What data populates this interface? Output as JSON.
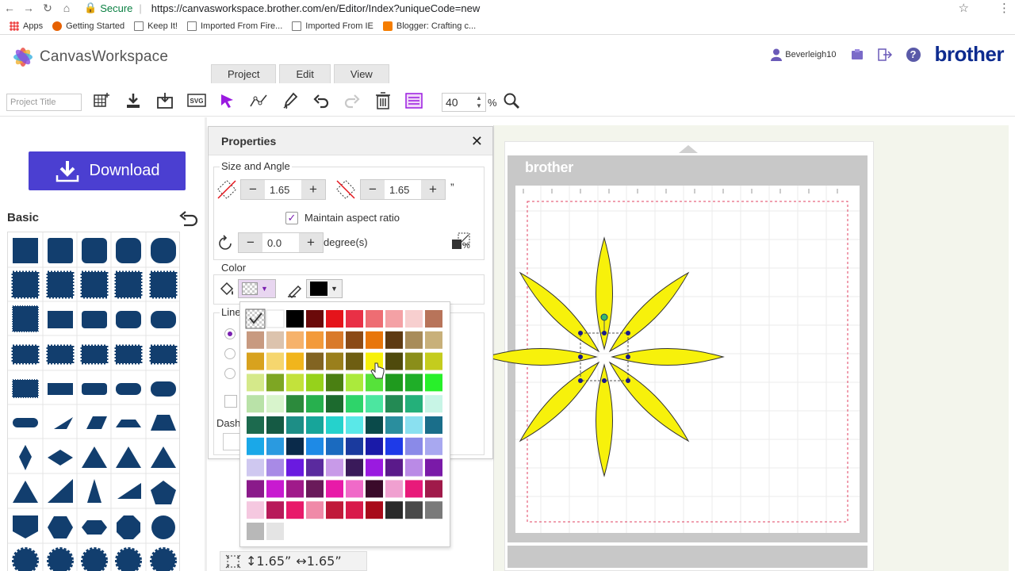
{
  "browser": {
    "secure_label": "Secure",
    "url": "https://canvasworkspace.brother.com/en/Editor/Index?uniqueCode=new",
    "bookmarks": [
      "Apps",
      "Getting Started",
      "Keep It!",
      "Imported From Fire...",
      "Imported From IE",
      "Blogger: Crafting c..."
    ]
  },
  "app": {
    "logo_text": "CanvasWorkspace",
    "tabs": [
      "Project",
      "Edit",
      "View"
    ],
    "username": "Beverleigh10",
    "brand": "brother"
  },
  "toolbar": {
    "project_title_placeholder": "Project Title",
    "zoom_value": "40",
    "zoom_unit": "%"
  },
  "left": {
    "download_label": "Download",
    "basic_title": "Basic"
  },
  "properties": {
    "title": "Properties",
    "size_angle_title": "Size and Angle",
    "width_value": "1.65",
    "height_value": "1.65",
    "unit_mark": "”",
    "maintain_aspect": "Maintain aspect ratio",
    "rotation_value": "0.0",
    "rotation_unit": "degree(s)",
    "color_title": "Color",
    "line_title_partial": "Line",
    "dash_title_partial": "Dash",
    "scale_icon_text": "%"
  },
  "palette": {
    "rows": [
      [
        "#e0e0e0",
        "#ffffff",
        "#000000",
        "#6b0a0a",
        "#e5141b",
        "#e93046",
        "#ee6d73",
        "#f4a1a5",
        "#f7cfcf",
        "#b8745a"
      ],
      [
        "#c89a80",
        "#dcc3ad",
        "#f6b26b",
        "#f39a3a",
        "#d97a2a",
        "#8b4a16",
        "#e8760b",
        "#5e3a12",
        "#a88c5a",
        "#c8b07a"
      ],
      [
        "#d8a21e",
        "#f6d66e",
        "#f1b51c",
        "#826422",
        "#9a7f1c",
        "#6e5e12",
        "#f7f10b",
        "#4f4a0c",
        "#8a8e1a",
        "#c4cc1e"
      ],
      [
        "#d5e98a",
        "#7ea623",
        "#c3e23b",
        "#96d21b",
        "#4a7f12",
        "#abea3c",
        "#56e23a",
        "#1f9a1e",
        "#1fae28",
        "#28f02a"
      ],
      [
        "#b9e2a8",
        "#d8f4cc",
        "#2c8a3c",
        "#27b04e",
        "#1c6a2e",
        "#2ed46a",
        "#4ce6a0",
        "#238a54",
        "#24b07a",
        "#c8f5e6"
      ],
      [
        "#1c6a4e",
        "#155a44",
        "#1d8e86",
        "#17a59a",
        "#25d2cc",
        "#5ae8e8",
        "#0a4a4a",
        "#2a8e9e",
        "#8ae0f0",
        "#1a6e8a"
      ],
      [
        "#1aa8e8",
        "#2a9ae0",
        "#0a2a4a",
        "#1e8ae6",
        "#1a6abf",
        "#1a3a9e",
        "#1a1aa8",
        "#1e3ae8",
        "#8a8ae8",
        "#a8a8f0"
      ],
      [
        "#cfc8f0",
        "#a88ae6",
        "#6a1ae0",
        "#5a2a9e",
        "#c89ae8",
        "#3a1a5a",
        "#9a1ae0",
        "#5a1a8a",
        "#ba8ae6",
        "#7a1aa8"
      ],
      [
        "#8a1a8a",
        "#c81ad0",
        "#a01a8a",
        "#6a1a5a",
        "#e81aa8",
        "#f06ac8",
        "#3a0a2a",
        "#f0a0d0",
        "#e81a7a",
        "#a01a4a"
      ],
      [
        "#f5c8e0",
        "#b81a5a",
        "#e81a6a",
        "#f08aa8",
        "#c01a3a",
        "#d81a4a",
        "#a80a1a",
        "#2a2a2a",
        "#4a4a4a",
        "#7a7a7a"
      ],
      [
        "#b8b8b8",
        "#e4e4e4"
      ]
    ]
  },
  "status": {
    "height_text": "↕1.65”",
    "width_text": "↔1.65”"
  }
}
